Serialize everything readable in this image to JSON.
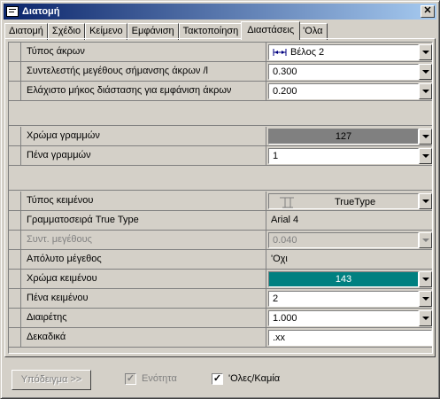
{
  "window": {
    "title": "Διατομή",
    "close_glyph": "✕"
  },
  "tabs": [
    {
      "label": "Διατομή"
    },
    {
      "label": "Σχέδιο"
    },
    {
      "label": "Κείμενο"
    },
    {
      "label": "Εμφάνιση"
    },
    {
      "label": "Τακτοποίηση"
    },
    {
      "label": "Διαστάσεις",
      "active": true
    },
    {
      "label": "'Ολα"
    }
  ],
  "rows": {
    "arrow_type": {
      "label": "Τύπος άκρων",
      "value": "Βέλος 2"
    },
    "arrow_factor": {
      "label": "Συντελεστής μεγέθους σήμανσης άκρων /l",
      "value": "0.300"
    },
    "min_length": {
      "label": "Ελάχιστο μήκος διάστασης για εμφάνιση άκρων",
      "value": "0.200"
    },
    "line_color": {
      "label": "Χρώμα γραμμών",
      "value": "127",
      "color": "#808080"
    },
    "line_pen": {
      "label": "Πένα γραμμών",
      "value": "1"
    },
    "text_type": {
      "label": "Τύπος κειμένου",
      "value": "TrueType"
    },
    "font": {
      "label": "Γραμματοσειρά True Type",
      "value": "Arial 4"
    },
    "size_factor": {
      "label": "Συντ. μεγέθους",
      "value": "0.040"
    },
    "abs_size": {
      "label": "Απόλυτο μέγεθος",
      "value": "'Οχι"
    },
    "text_color": {
      "label": "Χρώμα κειμένου",
      "value": "143",
      "color": "#008080"
    },
    "text_pen": {
      "label": "Πένα κειμένου",
      "value": "2"
    },
    "divisor": {
      "label": "Διαιρέτης",
      "value": "1.000"
    },
    "decimals": {
      "label": "Δεκαδικά",
      "value": ".xx"
    }
  },
  "footer": {
    "sample_button": "Υπόδειγμα >>",
    "unit_checkbox": {
      "label": "Ενότητα",
      "checked": true,
      "enabled": false
    },
    "all_none_checkbox": {
      "label": "'Ολες/Καμία",
      "checked": true,
      "enabled": true
    },
    "check_glyph": "✓"
  }
}
